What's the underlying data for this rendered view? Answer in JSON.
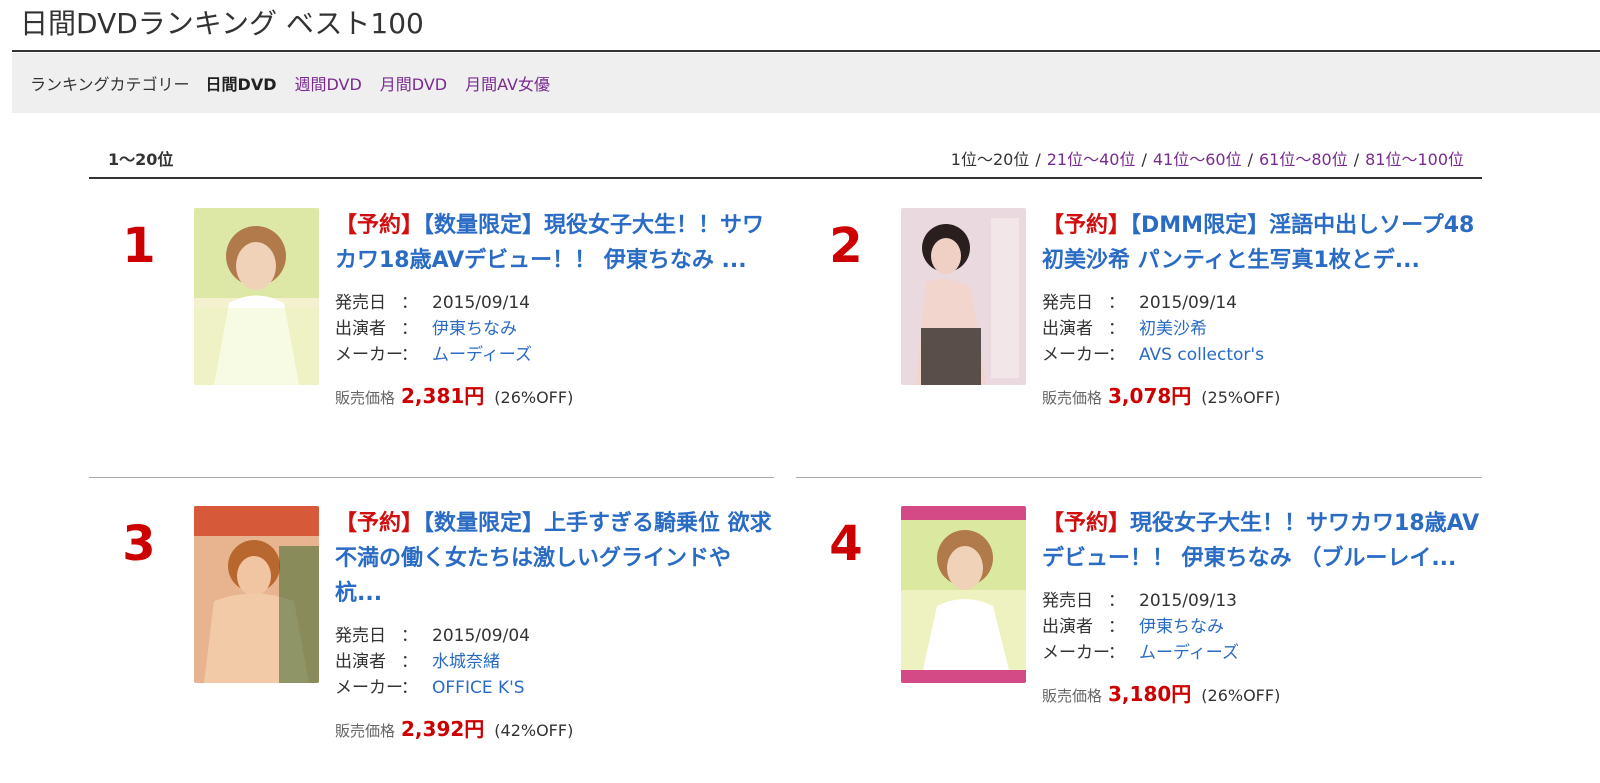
{
  "page_title": "日間DVDランキング ベスト100",
  "categories": {
    "label": "ランキングカテゴリー",
    "current": "日間DVD",
    "links": [
      "週間DVD",
      "月間DVD",
      "月間AV女優"
    ]
  },
  "range": {
    "title": "1〜20位",
    "current": "1位〜20位",
    "links": [
      "21位〜40位",
      "41位〜60位",
      "61位〜80位",
      "81位〜100位"
    ],
    "separator": "/"
  },
  "labels": {
    "release": "発売日",
    "cast": "出演者",
    "maker": "メーカー",
    "colon": "：",
    "price": "販売価格"
  },
  "items": [
    {
      "rank": "1",
      "tag": "【予約】",
      "title": "【数量限定】現役女子大生！！サワカワ18歳AVデビュー！！ 伊東ちなみ ...",
      "release": "2015/09/14",
      "cast": "伊東ちなみ",
      "maker": "ムーディーズ",
      "price": "2,381円",
      "discount": "(26%OFF)",
      "thumb_colors": [
        "#f4f2c8",
        "#c9e07a",
        "#e8c7a8"
      ]
    },
    {
      "rank": "2",
      "tag": "【予約】",
      "title": "【DMM限定】淫語中出しソープ48 初美沙希 パンティと生写真1枚とデ...",
      "release": "2015/09/14",
      "cast": "初美沙希",
      "maker": "AVS collector's",
      "price": "3,078円",
      "discount": "(25%OFF)",
      "thumb_colors": [
        "#e6d6dc",
        "#d8b3b6",
        "#2a2020"
      ]
    },
    {
      "rank": "3",
      "tag": "【予約】",
      "title": "【数量限定】上手すぎる騎乗位 欲求不満の働く女たちは激しいグラインドや杭...",
      "release": "2015/09/04",
      "cast": "水城奈緒",
      "maker": "OFFICE K'S",
      "price": "2,392円",
      "discount": "(42%OFF)",
      "thumb_colors": [
        "#d65a3a",
        "#efb89a",
        "#3a6a30"
      ]
    },
    {
      "rank": "4",
      "tag": "【予約】",
      "title": "現役女子大生！！サワカワ18歳AVデビュー！！ 伊東ちなみ （ブルーレイ...",
      "release": "2015/09/13",
      "cast": "伊東ちなみ",
      "maker": "ムーディーズ",
      "price": "3,180円",
      "discount": "(26%OFF)",
      "thumb_colors": [
        "#d44a86",
        "#c9e07a",
        "#f4f2c8"
      ]
    }
  ]
}
